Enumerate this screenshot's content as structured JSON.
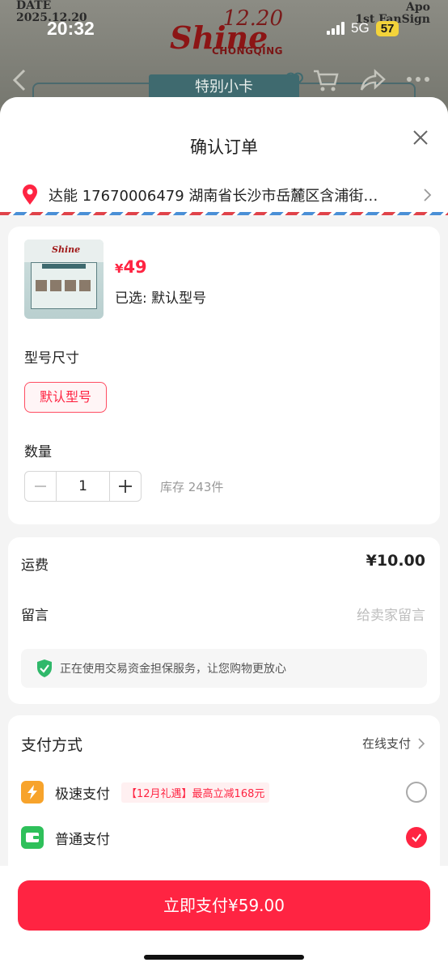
{
  "status_bar": {
    "time": "20:32",
    "network": "5G",
    "battery": "57"
  },
  "background": {
    "date_label": "DATE",
    "date_value": "2025.12.20",
    "artist": "Apo",
    "event": "1st FanSign",
    "logo_date": "12.20",
    "logo_name": "Shine",
    "logo_city": "CHONGQING",
    "tab_label": "特别小卡"
  },
  "sheet": {
    "title": "确认订单",
    "address": "达能 17670006479 湖南省长沙市岳麓区含浦街…"
  },
  "product": {
    "price_symbol": "¥",
    "price": "49",
    "selected_text": "已选: 默认型号",
    "size_label": "型号尺寸",
    "variant": "默认型号",
    "quantity_label": "数量",
    "quantity": "1",
    "stock": "库存 243件",
    "thumb_text": "Shine"
  },
  "shipping": {
    "fee_label": "运费",
    "fee_value": "¥10.00",
    "message_label": "留言",
    "message_placeholder": "给卖家留言",
    "guarantee": "正在使用交易资金担保服务，让您购物更放心"
  },
  "payment": {
    "title": "支付方式",
    "method": "在线支付",
    "options": [
      {
        "name": "极速支付",
        "promo": "【12月礼遇】最高立减168元",
        "selected": false,
        "icon": "lightning-icon",
        "color": "#f7a32b"
      },
      {
        "name": "普通支付",
        "promo": "",
        "selected": true,
        "icon": "wallet-icon",
        "color": "#2ec05a"
      }
    ]
  },
  "footer": {
    "pay_button": "立即支付¥59.00"
  },
  "colors": {
    "accent": "#ff2442",
    "shield": "#2fb86a"
  }
}
